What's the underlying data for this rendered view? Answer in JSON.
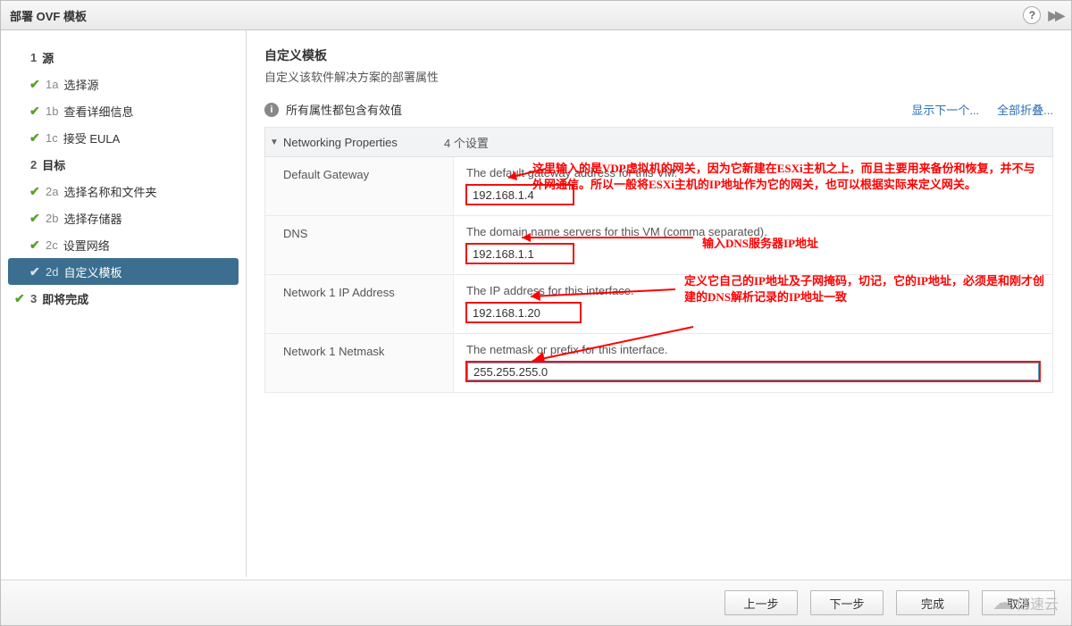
{
  "title": "部署 OVF 模板",
  "nav": {
    "sections": [
      {
        "num": "1",
        "label": "源",
        "done": false,
        "items": [
          {
            "num": "1a",
            "label": "选择源",
            "done": true
          },
          {
            "num": "1b",
            "label": "查看详细信息",
            "done": true
          },
          {
            "num": "1c",
            "label": "接受 EULA",
            "done": true
          }
        ]
      },
      {
        "num": "2",
        "label": "目标",
        "done": false,
        "items": [
          {
            "num": "2a",
            "label": "选择名称和文件夹",
            "done": true
          },
          {
            "num": "2b",
            "label": "选择存储器",
            "done": true
          },
          {
            "num": "2c",
            "label": "设置网络",
            "done": true
          },
          {
            "num": "2d",
            "label": "自定义模板",
            "done": true,
            "active": true
          }
        ]
      },
      {
        "num": "3",
        "label": "即将完成",
        "done": true,
        "items": []
      }
    ]
  },
  "main": {
    "heading": "自定义模板",
    "subtitle": "自定义该软件解决方案的部署属性",
    "status": "所有属性都包含有效值",
    "show_next": "显示下一个...",
    "collapse_all": "全部折叠...",
    "section_label": "Networking Properties",
    "section_count": "4 个设置",
    "props": [
      {
        "label": "Default Gateway",
        "desc": "The default gateway address for this VM.",
        "value": "192.168.1.4"
      },
      {
        "label": "DNS",
        "desc": "The domain name servers for this VM (comma separated).",
        "value": "192.168.1.1"
      },
      {
        "label": "Network 1 IP Address",
        "desc": "The IP address for this interface.",
        "value": "192.168.1.20"
      },
      {
        "label": "Network 1 Netmask",
        "desc": "The netmask or prefix for this interface.",
        "value": "255.255.255.0"
      }
    ]
  },
  "annotations": {
    "a1": "这里输入的是VDP虚拟机的网关，因为它新建在ESXi主机之上，而且主要用来备份和恢复，并不与外网通信。所以一般将ESXi主机的IP地址作为它的网关，也可以根据实际来定义网关。",
    "a2": "输入DNS服务器IP地址",
    "a3": "定义它自己的IP地址及子网掩码，切记，它的IP地址，必须是和刚才创建的DNS解析记录的IP地址一致"
  },
  "footer": {
    "back": "上一步",
    "next": "下一步",
    "finish": "完成",
    "cancel": "取消"
  },
  "watermark": "亿速云"
}
